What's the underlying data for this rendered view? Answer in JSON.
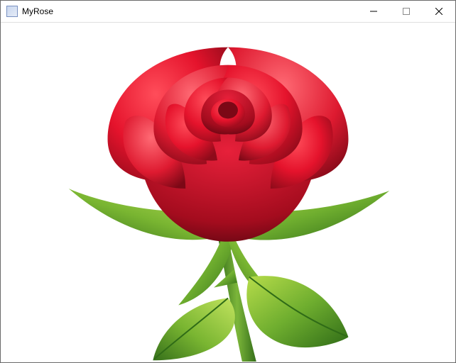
{
  "window": {
    "title": "MyRose",
    "icon_name": "app-icon"
  },
  "controls": {
    "minimize_name": "minimize-icon",
    "maximize_name": "maximize-icon",
    "close_name": "close-icon"
  },
  "content": {
    "subject": "rose-illustration"
  }
}
